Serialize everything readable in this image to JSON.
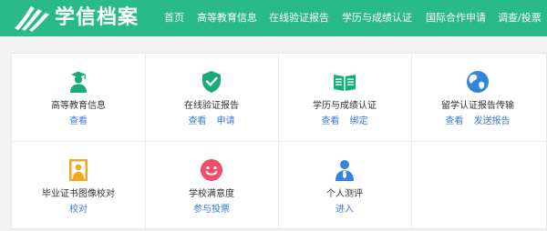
{
  "brand": {
    "name": "学信档案"
  },
  "nav": [
    {
      "label": "首页"
    },
    {
      "label": "高等教育信息"
    },
    {
      "label": "在线验证报告"
    },
    {
      "label": "学历与成绩认证"
    },
    {
      "label": "国际合作申请"
    },
    {
      "label": "调查/投票"
    }
  ],
  "colors": {
    "brand": "#2aba8a",
    "link": "#3b7bd4"
  },
  "services": [
    {
      "title": "高等教育信息",
      "icon": "graduate-icon",
      "links": [
        "查看"
      ]
    },
    {
      "title": "在线验证报告",
      "icon": "shield-check-icon",
      "links": [
        "查看",
        "申请"
      ]
    },
    {
      "title": "学历与成绩认证",
      "icon": "open-book-icon",
      "links": [
        "查看",
        "绑定"
      ]
    },
    {
      "title": "留学认证报告传输",
      "icon": "globe-icon",
      "links": [
        "查看",
        "发送报告"
      ]
    },
    {
      "title": "毕业证书图像校对",
      "icon": "portrait-photo-icon",
      "links": [
        "校对"
      ]
    },
    {
      "title": "学校满意度",
      "icon": "smiley-icon",
      "links": [
        "参与投票"
      ]
    },
    {
      "title": "个人测评",
      "icon": "person-tie-icon",
      "links": [
        "进入"
      ]
    }
  ]
}
